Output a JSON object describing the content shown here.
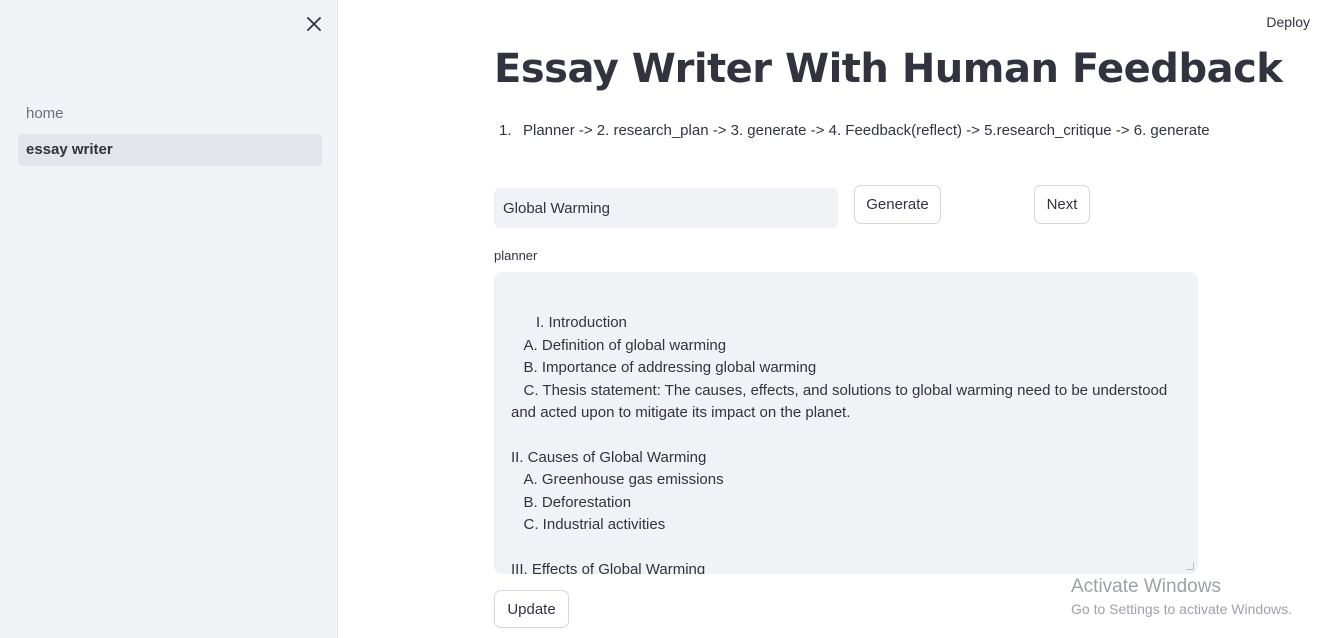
{
  "sidebar": {
    "close_label": "×",
    "items": [
      {
        "label": "home",
        "active": false
      },
      {
        "label": "essay writer",
        "active": true
      }
    ]
  },
  "header": {
    "deploy_label": "Deploy"
  },
  "main": {
    "title": "Essay Writer With Human Feedback",
    "steps": {
      "number": "1.",
      "text": "Planner -> 2. research_plan -> 3. generate -> 4. Feedback(reflect) -> 5.research_critique -> 6. generate"
    },
    "topic_input": {
      "value": "Global Warming",
      "placeholder": ""
    },
    "generate_label": "Generate",
    "next_label": "Next",
    "planner_label": "planner",
    "planner_text": "I. Introduction\n   A. Definition of global warming\n   B. Importance of addressing global warming\n   C. Thesis statement: The causes, effects, and solutions to global warming need to be understood and acted upon to mitigate its impact on the planet.\n\nII. Causes of Global Warming\n   A. Greenhouse gas emissions\n   B. Deforestation\n   C. Industrial activities\n\nIII. Effects of Global Warming\n   A. Rising global temperatures",
    "update_label": "Update"
  },
  "watermark": {
    "title": "Activate Windows",
    "subtitle": "Go to Settings to activate Windows."
  },
  "colors": {
    "sidebar_bg": "#f0f2f6",
    "active_item_bg": "#e2e5eb",
    "text": "#31333f",
    "input_bg": "#f0f2f6",
    "button_border": "#d5d8de"
  },
  "icons": {
    "close": "close-icon"
  }
}
